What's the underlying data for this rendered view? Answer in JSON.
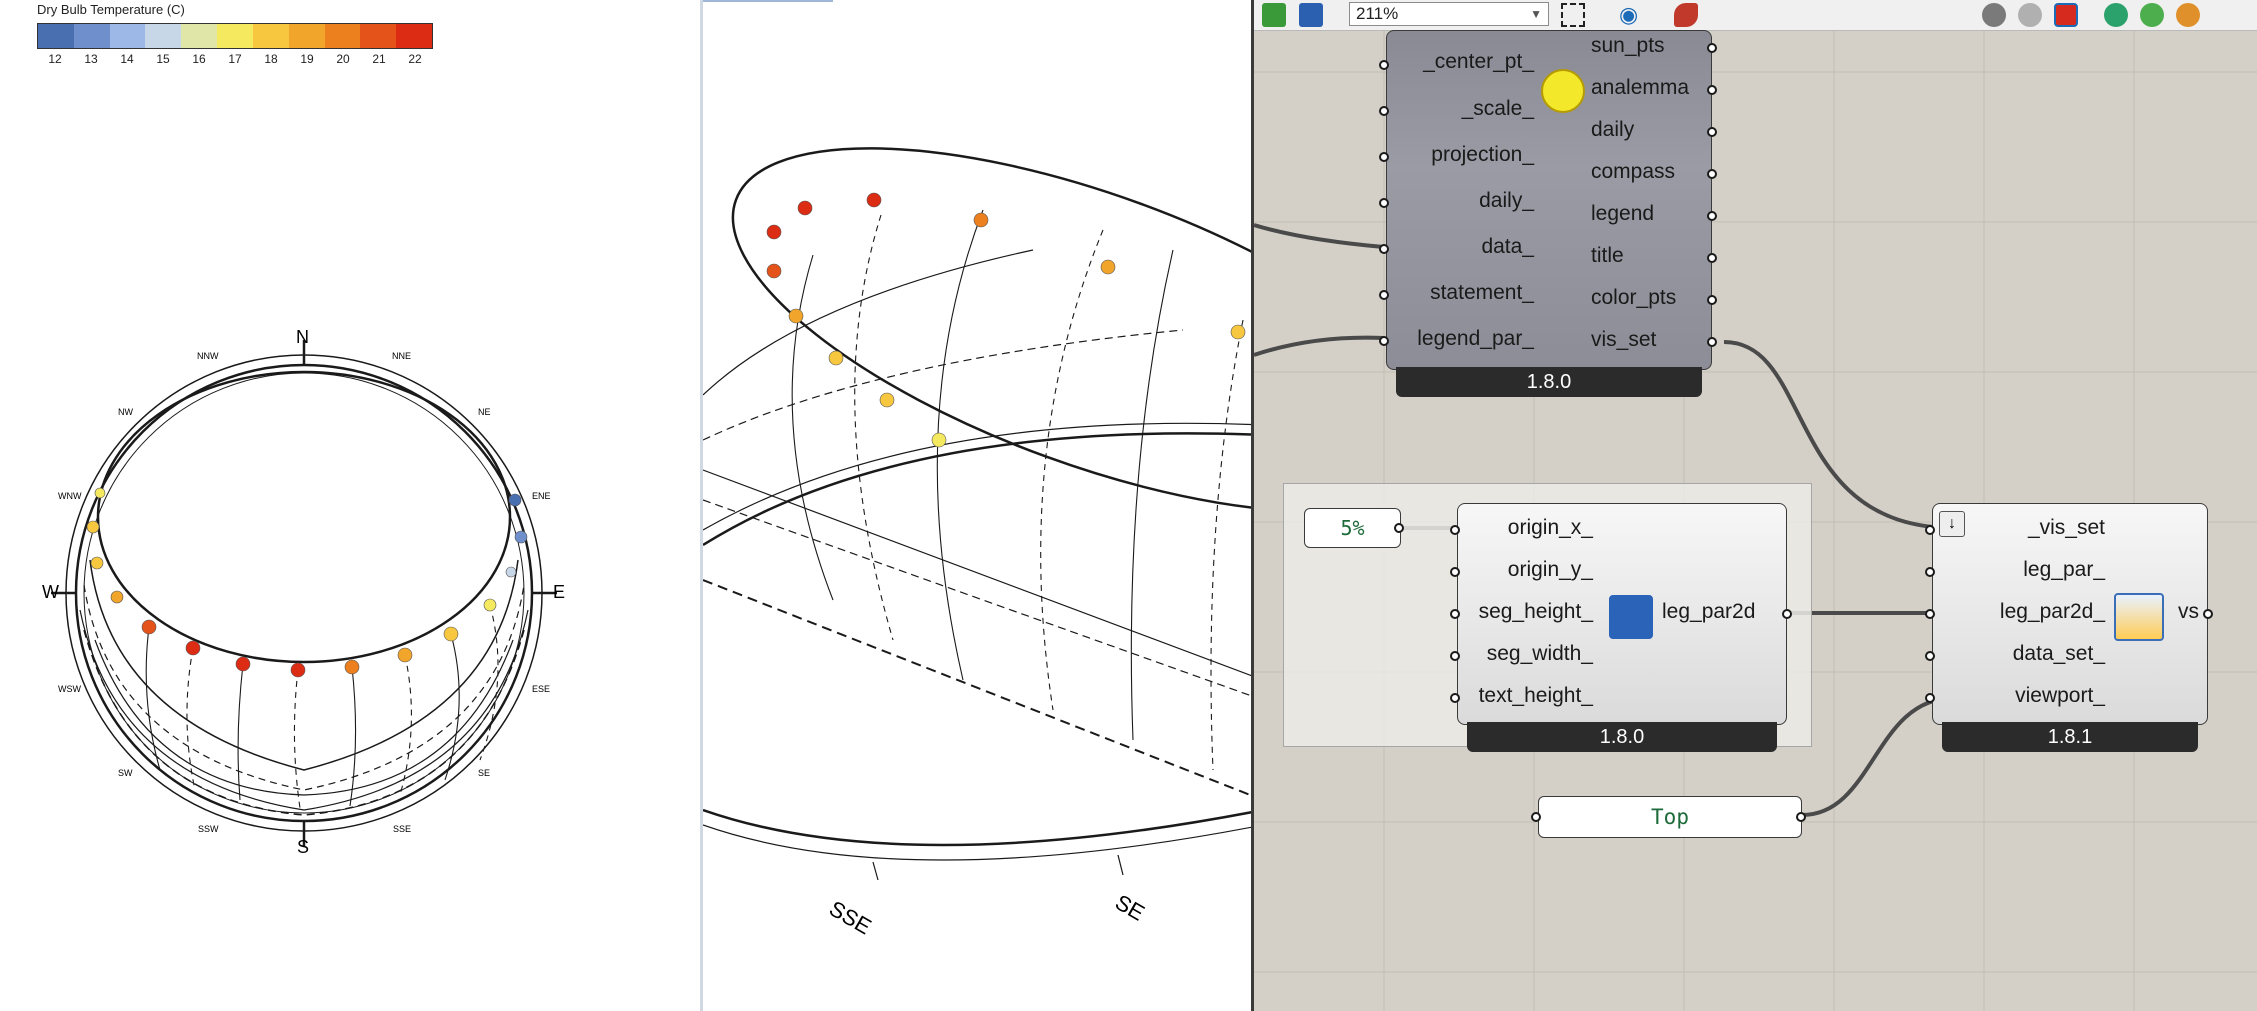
{
  "left_view": {
    "legend": {
      "title": "Dry Bulb Temperature (C)",
      "colors": [
        "#4a6fb0",
        "#6f8fcc",
        "#9db8e6",
        "#c8d7e8",
        "#dfe6a8",
        "#f5e960",
        "#f7c83f",
        "#f2a52b",
        "#ec7f1e",
        "#e4541a",
        "#dc2c14"
      ],
      "ticks": [
        "12",
        "13",
        "14",
        "15",
        "16",
        "17",
        "18",
        "19",
        "20",
        "21",
        "22"
      ]
    },
    "compass": {
      "cardinal": [
        "N",
        "E",
        "S",
        "W"
      ],
      "intercardinal": [
        "NNE",
        "NE",
        "ENE",
        "ESE",
        "SE",
        "SSE",
        "SSW",
        "SW",
        "WSW",
        "WNW",
        "NW",
        "NNW"
      ]
    }
  },
  "middle_view": {
    "labels": [
      "SSE",
      "SE"
    ]
  },
  "toolbar": {
    "zoom": "211%",
    "icons": [
      "open-file-icon",
      "save-icon",
      "zoom-fit-icon",
      "preview-eye-icon",
      "sketch-pen-icon",
      "preview-off-icon",
      "preview-wire-icon",
      "preview-shaded-icon",
      "preview-selected-icon",
      "bake-icon",
      "render-sphere-icon"
    ]
  },
  "canvas": {
    "sunpath_component": {
      "inputs": [
        "_center_pt_",
        "_scale_",
        "projection_",
        "daily_",
        "data_",
        "statement_",
        "legend_par_"
      ],
      "outputs": [
        "sun_pts",
        "analemma",
        "daily",
        "compass",
        "legend",
        "title",
        "color_pts",
        "vis_set"
      ],
      "version": "1.8.0"
    },
    "legend_component": {
      "inputs": [
        "origin_x_",
        "origin_y_",
        "seg_height_",
        "seg_width_",
        "text_height_"
      ],
      "outputs": [
        "leg_par2d"
      ],
      "version": "1.8.0"
    },
    "vis_component": {
      "inputs": [
        "_vis_set",
        "leg_par_",
        "leg_par2d_",
        "data_set_",
        "viewport_"
      ],
      "outputs": [
        "vs"
      ],
      "version": "1.8.1"
    },
    "slider_value": "5%",
    "panel_value": "Top"
  }
}
